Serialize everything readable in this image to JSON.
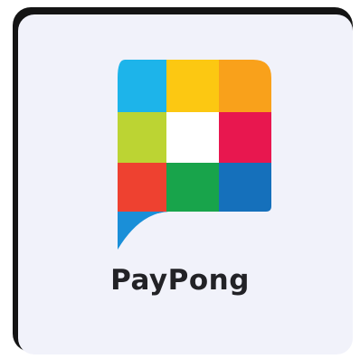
{
  "app": {
    "name": "PayPong",
    "icon": "paypong-logo-icon"
  },
  "colors": {
    "frame": "#141414",
    "tile_background": "#f1f2fa",
    "text": "#222226",
    "logo_cells": {
      "top_left": "#1db4ea",
      "top_middle": "#fcc812",
      "top_right": "#f9a11b",
      "middle_left": "#bcd433",
      "middle_center": "#ffffff",
      "middle_right": "#e8174f",
      "bottom_left": "#ee4130",
      "bottom_middle": "#18a44b",
      "bottom_right": "#1570bb",
      "tail": "#1a8fd8"
    }
  }
}
